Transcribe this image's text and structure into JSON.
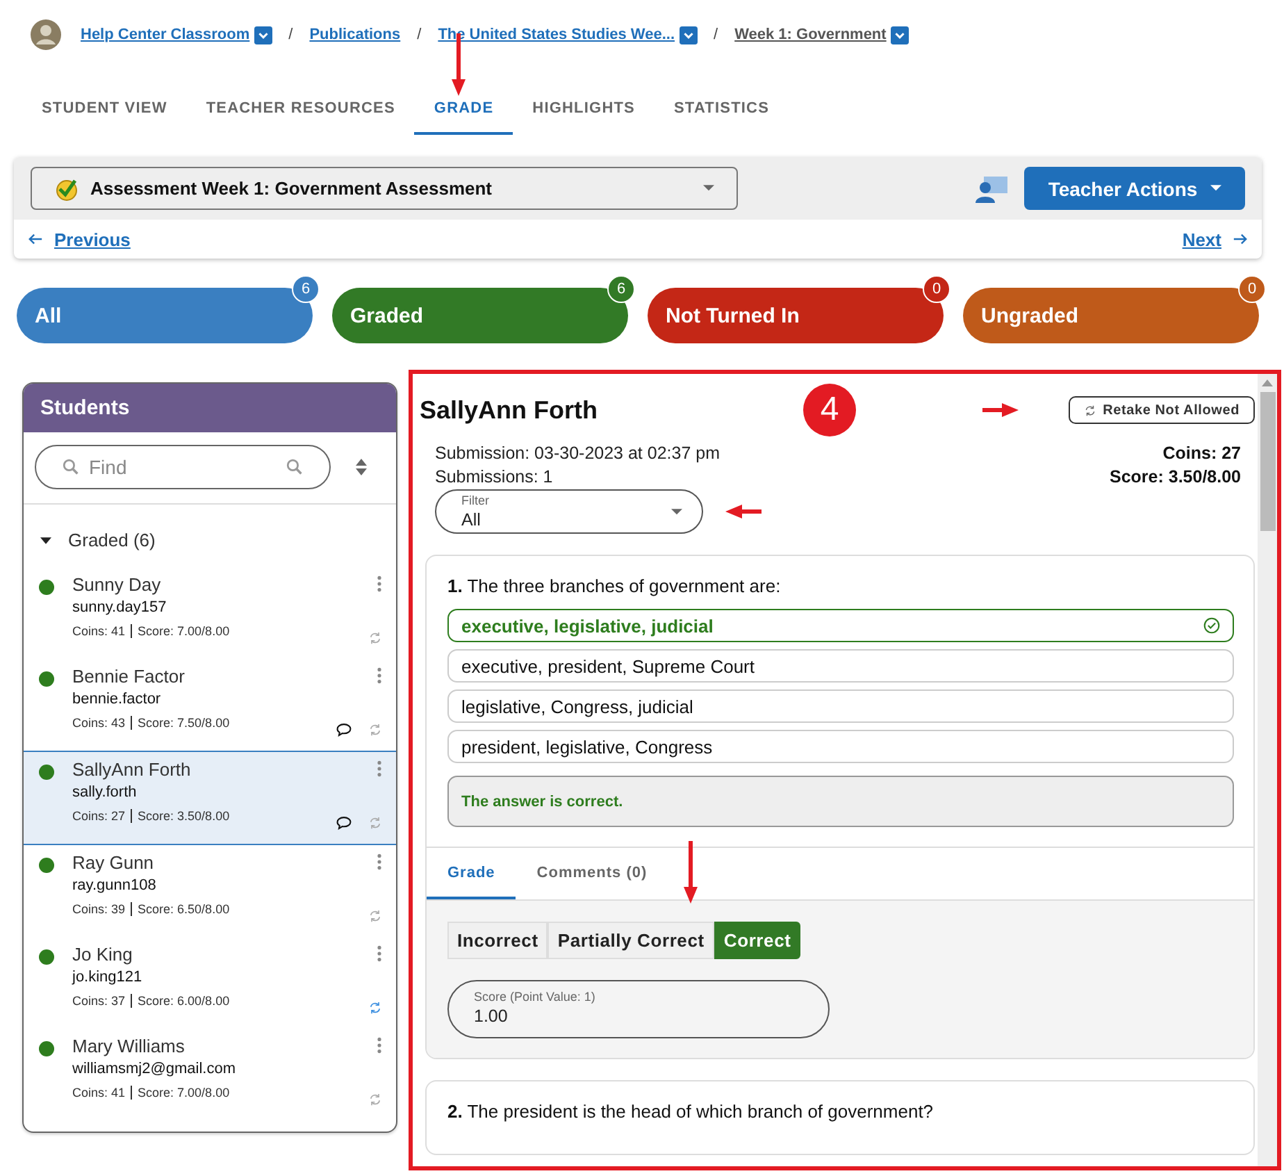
{
  "breadcrumb": [
    {
      "label": "Help Center Classroom",
      "kind": "link",
      "dropdown": true
    },
    {
      "separator": "/",
      "label": "Publications",
      "kind": "link",
      "dropdown": false
    },
    {
      "separator": "/",
      "label": "The United States Studies Wee...",
      "kind": "link",
      "dropdown": true
    },
    {
      "separator": "/",
      "label": "Week 1: Government",
      "kind": "current",
      "dropdown": true
    }
  ],
  "tabs": [
    {
      "label": "STUDENT VIEW",
      "selected": false,
      "arrow": false
    },
    {
      "label": "TEACHER RESOURCES",
      "selected": false,
      "arrow": false
    },
    {
      "label": "GRADE",
      "selected": true,
      "arrow": true
    },
    {
      "label": "HIGHLIGHTS",
      "selected": false,
      "arrow": false
    },
    {
      "label": "STATISTICS",
      "selected": false,
      "arrow": false
    }
  ],
  "assessment_select": {
    "value": "Assessment Week 1: Government Assessment"
  },
  "teacher_actions": {
    "label": "Teacher Actions"
  },
  "nav": {
    "previous": "Previous",
    "next": "Next"
  },
  "status_filters": [
    {
      "label": "All",
      "count": "6",
      "color": "#3a7fc1"
    },
    {
      "label": "Graded",
      "count": "6",
      "color": "#327a26"
    },
    {
      "label": "Not Turned In",
      "count": "0",
      "color": "#c42716"
    },
    {
      "label": "Ungraded",
      "count": "0",
      "color": "#bf5a1a"
    }
  ],
  "students_panel": {
    "title": "Students",
    "search_placeholder": "Find",
    "group": {
      "label": "Graded (6)",
      "expanded": true
    },
    "students": [
      {
        "name": "Sunny Day",
        "username": "sunny.day157",
        "coins": "Coins: 41",
        "score": "Score: 7.00/8.00",
        "selected": false,
        "has_comment": false,
        "retake_active": false
      },
      {
        "name": "Bennie Factor",
        "username": "bennie.factor",
        "coins": "Coins: 43",
        "score": "Score: 7.50/8.00",
        "selected": false,
        "has_comment": true,
        "retake_active": false
      },
      {
        "name": "SallyAnn Forth",
        "username": "sally.forth",
        "coins": "Coins: 27",
        "score": "Score: 3.50/8.00",
        "selected": true,
        "has_comment": true,
        "retake_active": false
      },
      {
        "name": "Ray Gunn",
        "username": "ray.gunn108",
        "coins": "Coins: 39",
        "score": "Score: 6.50/8.00",
        "selected": false,
        "has_comment": false,
        "retake_active": false
      },
      {
        "name": "Jo King",
        "username": "jo.king121",
        "coins": "Coins: 37",
        "score": "Score: 6.00/8.00",
        "selected": false,
        "has_comment": false,
        "retake_active": true
      },
      {
        "name": "Mary Williams",
        "username": "williamsmj2@gmail.com",
        "coins": "Coins: 41",
        "score": "Score: 7.00/8.00",
        "selected": false,
        "has_comment": false,
        "retake_active": false
      }
    ]
  },
  "detail": {
    "highlighted": true,
    "step": "4",
    "name": "SallyAnn Forth",
    "retake_button": {
      "label": "Retake Not Allowed",
      "arrow": true
    },
    "submission": "Submission: 03-30-2023 at 02:37 pm",
    "submissions": "Submissions: 1",
    "coins": "Coins: 27",
    "score": "Score: 3.50/8.00",
    "filter": {
      "label": "Filter",
      "value": "All",
      "arrow": true
    },
    "questions": [
      {
        "number": "1.",
        "text": "The three branches of government are:",
        "options": [
          {
            "label": "executive, legislative, judicial",
            "correct": true
          },
          {
            "label": "executive, president, Supreme Court",
            "correct": false
          },
          {
            "label": "legislative, Congress, judicial",
            "correct": false
          },
          {
            "label": "president, legislative, Congress",
            "correct": false
          }
        ],
        "feedback": "The answer is correct.",
        "grade_tabs": [
          {
            "label": "Grade",
            "selected": true
          },
          {
            "label": "Comments (0)",
            "selected": false
          }
        ],
        "grade_options": [
          {
            "label": "Incorrect",
            "selected": false,
            "arrow": false
          },
          {
            "label": "Partially Correct",
            "selected": false,
            "arrow": true
          },
          {
            "label": "Correct",
            "selected": true,
            "arrow": false
          }
        ],
        "score_field": {
          "label": "Score (Point Value: 1)",
          "value": "1.00"
        }
      },
      {
        "number": "2.",
        "text": "The president is the head of which branch of government?"
      }
    ]
  }
}
